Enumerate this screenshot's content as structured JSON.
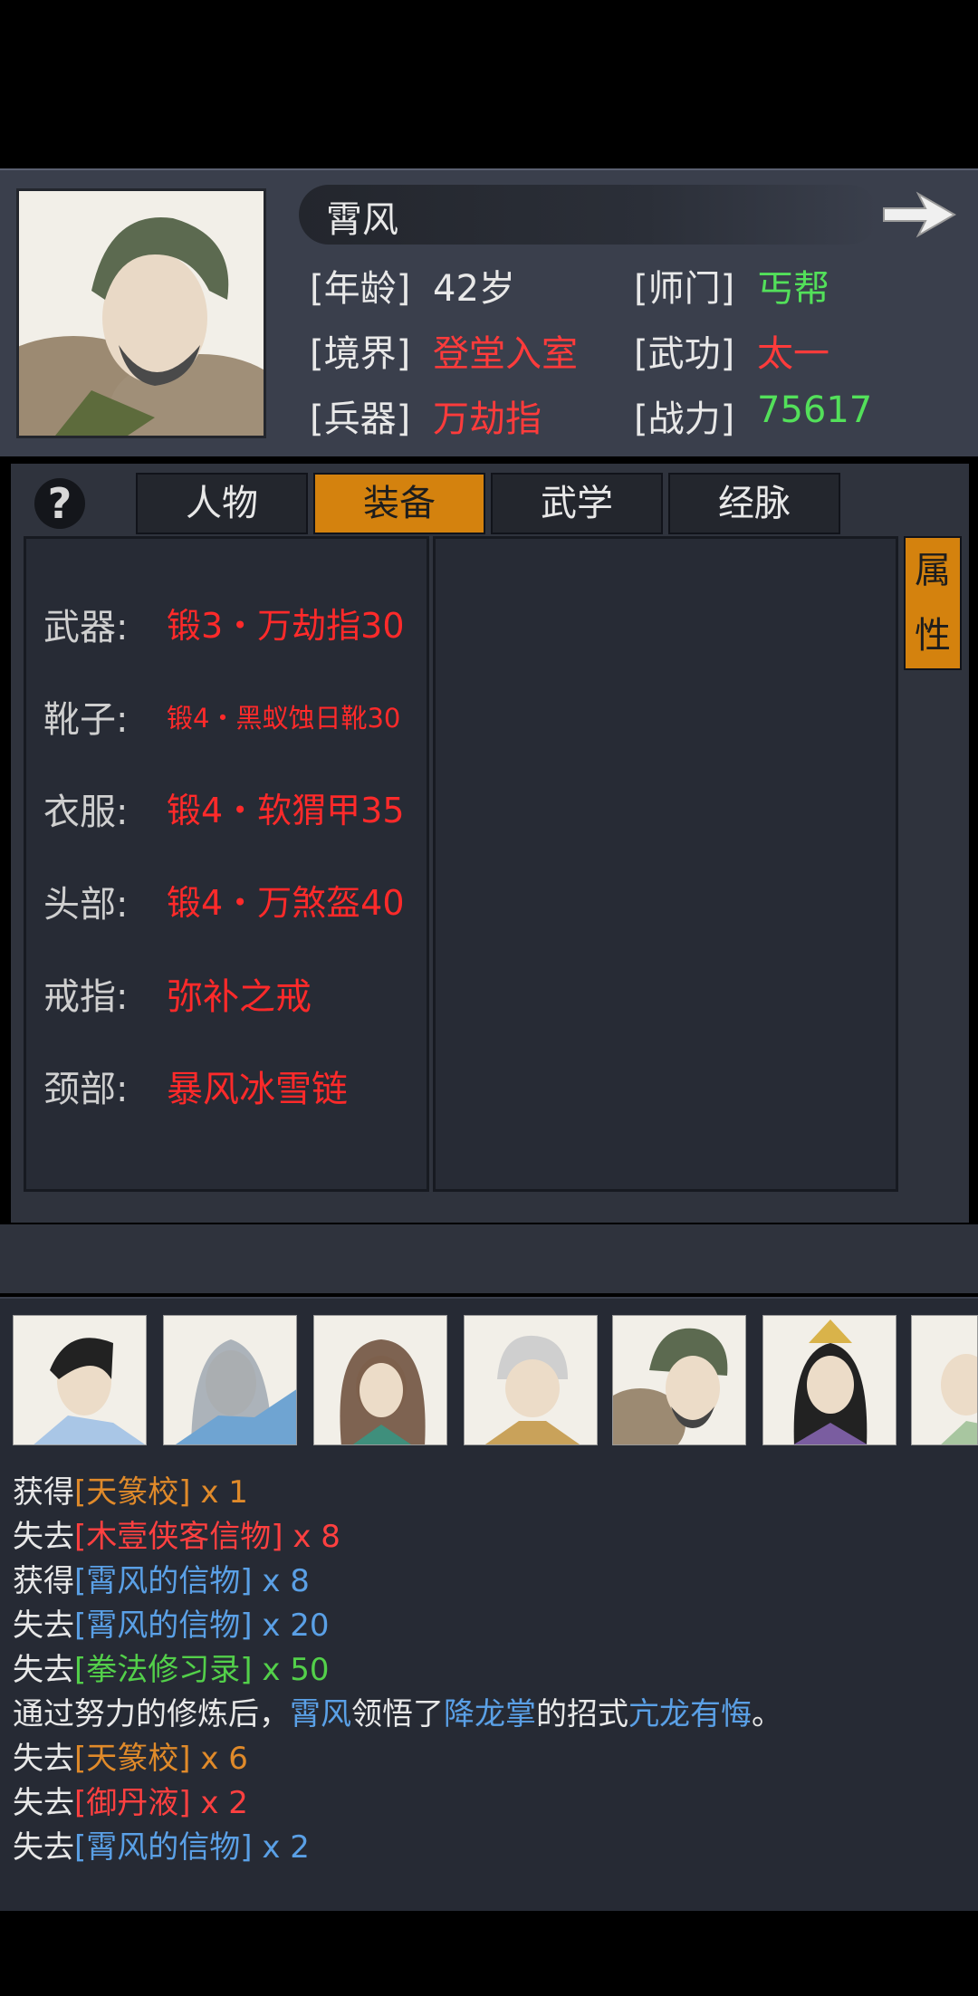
{
  "hero": {
    "name": "霄风",
    "rows": [
      {
        "label1": "[年龄]",
        "value1": "42岁",
        "label2": "[师门]",
        "value2": "丐帮"
      },
      {
        "label1": "[境界]",
        "value1": "登堂入室",
        "label2": "[武功]",
        "value2": "太一"
      },
      {
        "label1": "[兵器]",
        "value1": "万劫指",
        "label2": "[战力]",
        "value2": "75617"
      }
    ]
  },
  "tabs": {
    "help": "?",
    "items": [
      "人物",
      "装备",
      "武学",
      "经脉"
    ],
    "active": "装备",
    "side_tab": [
      "属",
      "性"
    ]
  },
  "equipment": [
    {
      "slot": "武器:",
      "item": "锻3・万劫指30"
    },
    {
      "slot": "靴子:",
      "item": "锻4・黑蚁蚀日靴30"
    },
    {
      "slot": "衣服:",
      "item": "锻4・软猬甲35"
    },
    {
      "slot": "头部:",
      "item": "锻4・万煞盔40"
    },
    {
      "slot": "戒指:",
      "item": "弥补之戒"
    },
    {
      "slot": "颈部:",
      "item": "暴风冰雪链"
    }
  ],
  "roster": [
    "character-1",
    "character-2",
    "character-3",
    "character-4",
    "character-5",
    "character-6",
    "character-7"
  ],
  "log": [
    {
      "action": "获得",
      "item": "[天篆校]",
      "qty": "x 1",
      "color": "orange"
    },
    {
      "action": "失去",
      "item": "[木壹侠客信物]",
      "qty": "x 8",
      "color": "red"
    },
    {
      "action": "获得",
      "item": "[霄风的信物]",
      "qty": "x 8",
      "color": "blue"
    },
    {
      "action": "失去",
      "item": "[霄风的信物]",
      "qty": "x 20",
      "color": "blue"
    },
    {
      "action": "失去",
      "item": "[拳法修习录]",
      "qty": "x 50",
      "color": "green"
    },
    {
      "action": "失去",
      "item": "[天篆校]",
      "qty": "x 6",
      "color": "orange"
    },
    {
      "action": "失去",
      "item": "[御丹液]",
      "qty": "x 2",
      "color": "red"
    },
    {
      "action": "失去",
      "item": "[霄风的信物]",
      "qty": "x 2",
      "color": "blue"
    }
  ],
  "log_special": {
    "p1": "通过努力的修炼后，",
    "who": "霄风",
    "p2": "领悟了",
    "skill": "降龙掌",
    "p3": "的招式",
    "move": "亢龙有悔",
    "p4": "。"
  },
  "colors": {
    "accent": "#d4820e",
    "red": "#ff2a2a",
    "green": "#53e05a",
    "blue": "#5aa0e6",
    "orange": "#e08a2a"
  }
}
